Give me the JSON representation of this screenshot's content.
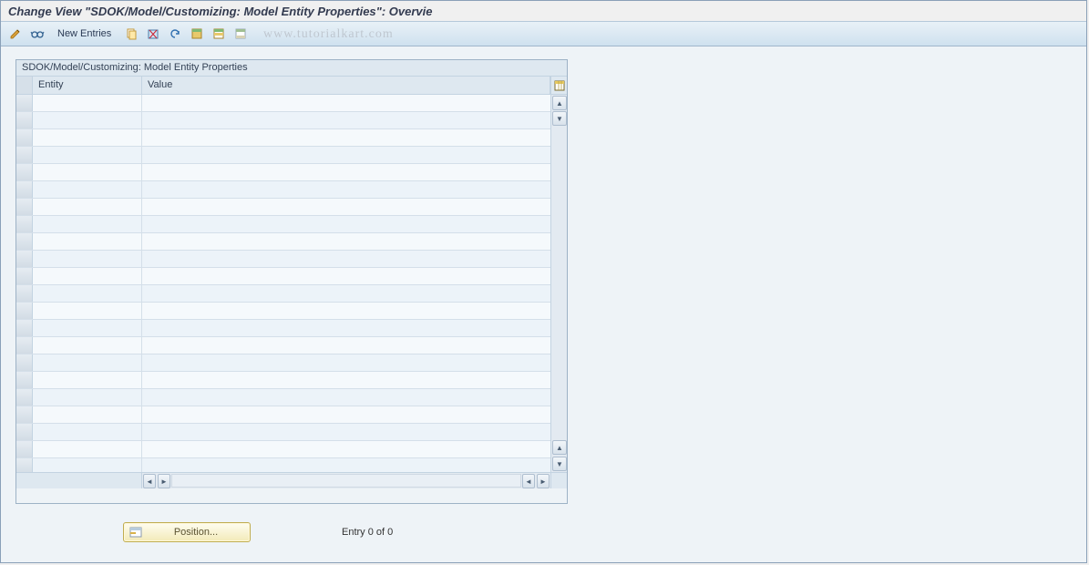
{
  "page_title": "Change View \"SDOK/Model/Customizing: Model Entity Properties\": Overvie",
  "toolbar": {
    "new_entries_label": "New Entries"
  },
  "watermark": "www.tutorialkart.com",
  "panel": {
    "title": "SDOK/Model/Customizing: Model Entity Properties",
    "col_entity": "Entity",
    "col_value": "Value"
  },
  "footer": {
    "position_label": "Position...",
    "entry_info": "Entry 0 of 0"
  },
  "icons": {
    "pencil": "pencil-icon",
    "glasses": "glasses-icon",
    "copy": "copy-icon",
    "delete": "delete-icon",
    "undo": "undo-icon",
    "select_all": "select-all-icon",
    "select_block": "select-block-icon",
    "deselect": "deselect-icon",
    "config": "table-settings-icon",
    "layout": "layout-icon"
  },
  "row_count": 22
}
